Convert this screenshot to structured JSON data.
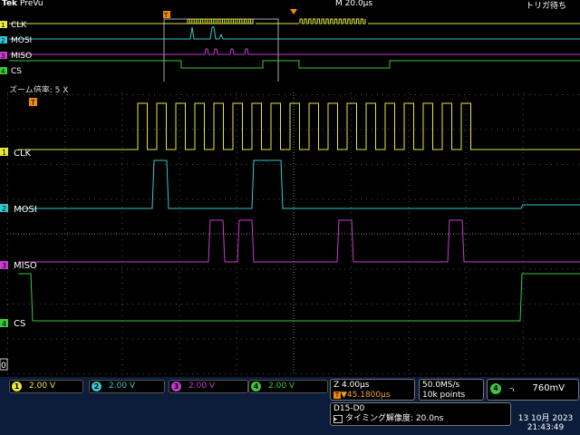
{
  "header": {
    "brand": "Tek",
    "mode": "PreVu",
    "timebase": "M 20.0µs",
    "trigger_status": "トリガ待ち"
  },
  "zoom": {
    "label": "ズーム倍率: 5 X"
  },
  "channels": [
    {
      "num": "1",
      "name": "CLK",
      "color": "#e8e83a"
    },
    {
      "num": "2",
      "name": "MOSI",
      "color": "#32c8d2"
    },
    {
      "num": "3",
      "name": "MISO",
      "color": "#c83ccc"
    },
    {
      "num": "4",
      "name": "CS",
      "color": "#3cc83c"
    }
  ],
  "scales": [
    {
      "num": "1",
      "value": "2.00 V"
    },
    {
      "num": "2",
      "value": "2.00 V"
    },
    {
      "num": "3",
      "value": "2.00 V"
    },
    {
      "num": "4",
      "value": "2.00 V"
    }
  ],
  "trigger_settings": {
    "channel": "4",
    "slope_icon": "falling-edge-icon",
    "level": "760mV"
  },
  "zoom_panel": {
    "line1": "Z 4.00µs",
    "line2": "▼45.1800µs"
  },
  "acquisition": {
    "rate": "50.0MS/s",
    "points": "10k points"
  },
  "bus": {
    "label": "D15-D0",
    "timing": "タイミング解像度: 20.0ns"
  },
  "datetime": {
    "date": "13 10月 2023",
    "time": "21:43:49"
  },
  "ground_marker": "0"
}
